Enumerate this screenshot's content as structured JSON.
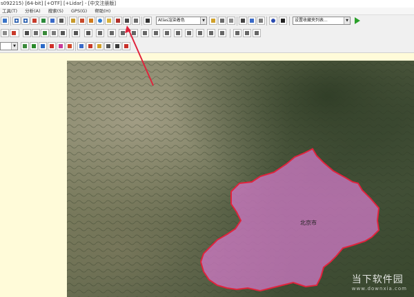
{
  "window": {
    "title": "s092215) [64-bit] [+OTF] [+Lidar] - [中文注册版]"
  },
  "menu": {
    "items": [
      "工具(T)",
      "分析(A)",
      "搜索(S)",
      "GPS(G)",
      "帮助(H)"
    ]
  },
  "toolbar": {
    "imagery_select": "Atlas渲染着色",
    "waypoint_select": "设置收藏夹列表..."
  },
  "map": {
    "region_label": "北京市",
    "region_fill": "#d27ac8",
    "region_border": "#e0233c",
    "arrow_color": "#e0233c"
  },
  "watermark": {
    "text": "当下软件园",
    "url": "www.downxia.com"
  },
  "colors": {
    "left_panel_bg": "#fffbd9",
    "toolbar_bg": "#f0f0f0",
    "go_button": "#2aa02a"
  }
}
